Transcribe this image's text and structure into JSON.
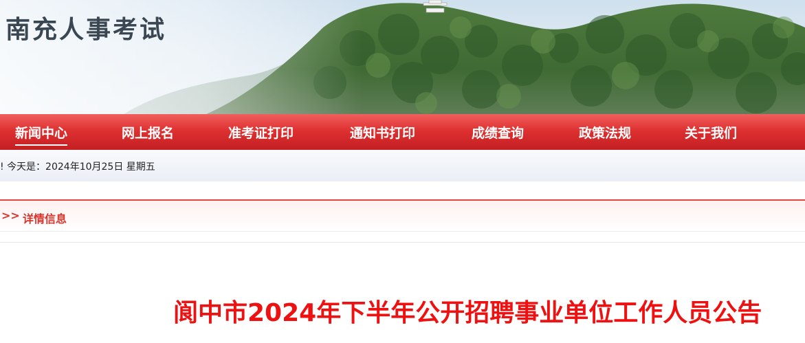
{
  "site": {
    "title": "南充人事考试"
  },
  "nav": {
    "items": [
      {
        "label": "新闻中心",
        "active": true
      },
      {
        "label": "网上报名"
      },
      {
        "label": "准考证打印"
      },
      {
        "label": "通知书打印"
      },
      {
        "label": "成绩查询"
      },
      {
        "label": "政策法规"
      },
      {
        "label": "关于我们"
      }
    ]
  },
  "datebar": {
    "text": "!  今天是：2024年10月25日 星期五"
  },
  "section": {
    "chevron": ">>",
    "label": "详情信息"
  },
  "article": {
    "title": "阆中市2024年下半年公开招聘事业单位工作人员公告"
  },
  "colors": {
    "nav_red": "#de3131",
    "accent_red": "#d9342b",
    "title_red": "#ee1111"
  }
}
